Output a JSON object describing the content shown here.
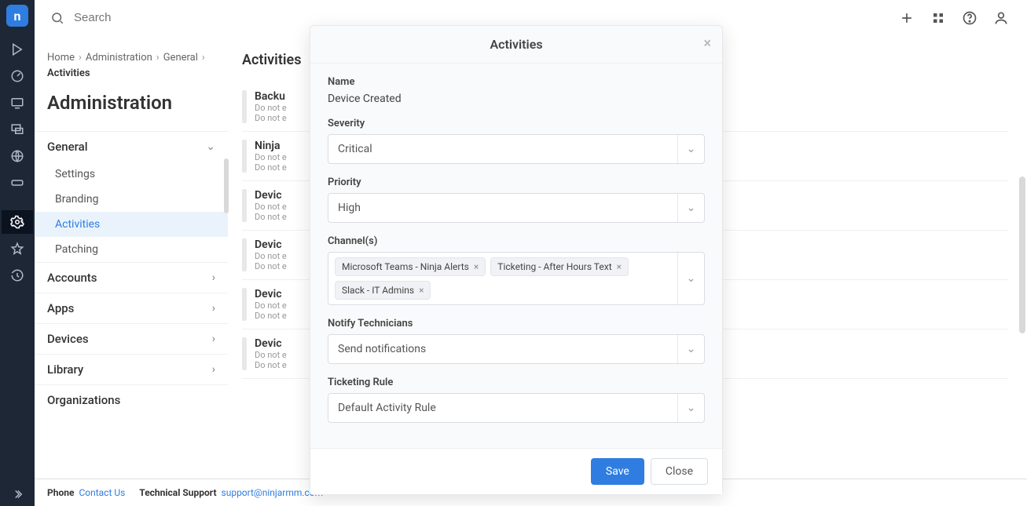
{
  "search": {
    "placeholder": "Search"
  },
  "breadcrumb": {
    "home": "Home",
    "admin": "Administration",
    "general": "General",
    "activities": "Activities"
  },
  "page_title": "Administration",
  "sidebar": {
    "sections": {
      "general": "General",
      "accounts": "Accounts",
      "apps": "Apps",
      "devices": "Devices",
      "library": "Library",
      "organizations": "Organizations"
    },
    "general_items": {
      "settings": "Settings",
      "branding": "Branding",
      "activities": "Activities",
      "patching": "Patching"
    }
  },
  "list": {
    "title": "Activities",
    "sub1": "Do not e",
    "sub2": "Do not e",
    "items": [
      {
        "name": "Backu"
      },
      {
        "name": "Ninja"
      },
      {
        "name": "Devic"
      },
      {
        "name": "Devic"
      },
      {
        "name": "Devic"
      },
      {
        "name": "Devic"
      }
    ]
  },
  "modal": {
    "title": "Activities",
    "name_label": "Name",
    "name_value": "Device Created",
    "severity_label": "Severity",
    "severity_value": "Critical",
    "priority_label": "Priority",
    "priority_value": "High",
    "channels_label": "Channel(s)",
    "channels": [
      "Microsoft Teams - Ninja Alerts",
      "Ticketing - After Hours Text",
      "Slack - IT Admins"
    ],
    "notify_label": "Notify Technicians",
    "notify_value": "Send notifications",
    "ticketing_label": "Ticketing Rule",
    "ticketing_value": "Default Activity Rule",
    "save": "Save",
    "close": "Close"
  },
  "footer": {
    "phone_label": "Phone",
    "contact": "Contact Us",
    "support_label": "Technical Support",
    "support_email": "support@ninjarmm.com"
  }
}
